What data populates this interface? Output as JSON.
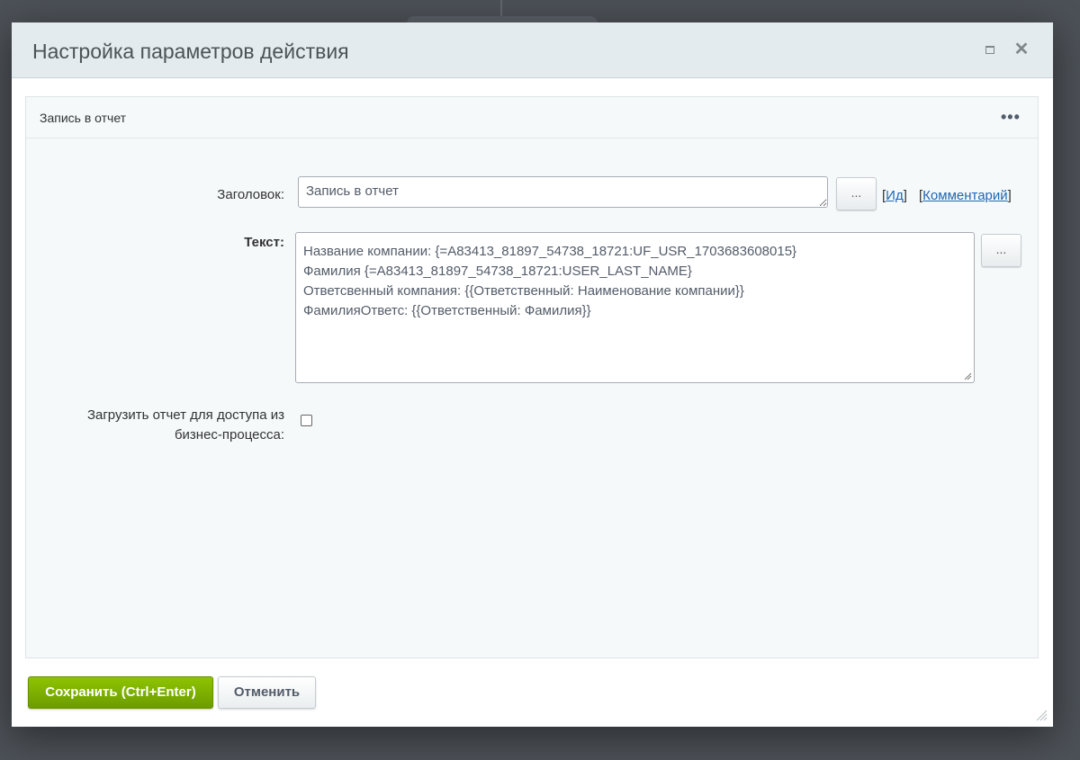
{
  "dialog": {
    "title": "Настройка параметров действия"
  },
  "panel": {
    "title": "Запись в отчет",
    "more_icon": "•••"
  },
  "form": {
    "title_label": "Заголовок:",
    "title_value": "Запись в отчет",
    "text_label": "Текст:",
    "text_lines": [
      "Название компании: {=A83413_81897_54738_18721:UF_USR_1703683608015}",
      "Фамилия {=A83413_81897_54738_18721:USER_LAST_NAME}",
      "Ответсвенный компания: {{Ответственный: Наименование компании}}",
      "ФамилияОтветс: {{Ответственный: Фамилия}}"
    ],
    "dots_label": "...",
    "link_id": "Ид",
    "link_comment": "Комментарий",
    "upload_label_line1": "Загрузить отчет для доступа из",
    "upload_label_line2": "бизнес-процесса:",
    "upload_checked": false
  },
  "footer": {
    "save_label": "Сохранить (Ctrl+Enter)",
    "cancel_label": "Отменить"
  },
  "colors": {
    "save_button": "#7bb300",
    "link": "#2067b0",
    "header_bg": "#e4ebee"
  },
  "icons": {
    "maximize": "maximize-icon",
    "close": "close-icon",
    "more": "more-dots-icon",
    "resize": "resize-grip-icon"
  }
}
